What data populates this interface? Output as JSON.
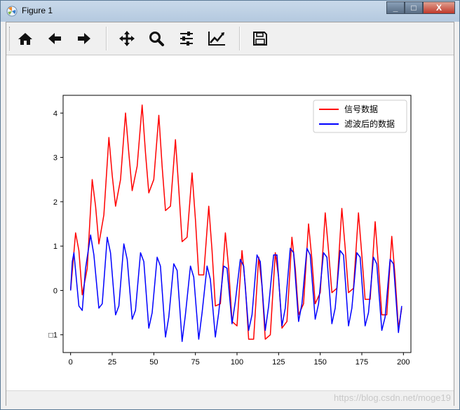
{
  "window": {
    "title": "Figure 1",
    "minimize": "_",
    "maximize": "□",
    "close": "X"
  },
  "toolbar": {
    "buttons": [
      {
        "name": "home",
        "icon": "home-icon"
      },
      {
        "name": "back",
        "icon": "arrow-left-icon"
      },
      {
        "name": "forward",
        "icon": "arrow-right-icon"
      },
      {
        "name": "pan",
        "icon": "move-icon"
      },
      {
        "name": "zoom",
        "icon": "magnifier-icon"
      },
      {
        "name": "subplots",
        "icon": "sliders-icon"
      },
      {
        "name": "edit-axis",
        "icon": "line-chart-icon"
      },
      {
        "name": "save",
        "icon": "floppy-disk-icon"
      }
    ]
  },
  "status": {
    "watermark": "https://blog.csdn.net/moge19"
  },
  "chart_data": {
    "type": "line",
    "title": "",
    "xlabel": "",
    "ylabel": "",
    "xlim": [
      -4.5,
      204.5
    ],
    "ylim": [
      -1.4,
      4.4
    ],
    "xticks": [
      "0",
      "25",
      "50",
      "75",
      "100",
      "125",
      "150",
      "175",
      "200"
    ],
    "yticks": [
      "□1",
      "0",
      "1",
      "2",
      "3",
      "4"
    ],
    "legend_position": "top-right",
    "series": [
      {
        "name": "信号数据",
        "color": "#ff0000",
        "x": [
          0,
          3,
          5,
          7,
          10,
          13,
          15,
          17,
          20,
          23,
          25,
          27,
          30,
          33,
          35,
          37,
          40,
          43,
          45,
          47,
          50,
          53,
          55,
          57,
          60,
          63,
          65,
          67,
          70,
          73,
          75,
          77,
          80,
          83,
          85,
          87,
          90,
          93,
          95,
          97,
          100,
          103,
          105,
          107,
          110,
          113,
          115,
          117,
          120,
          123,
          125,
          127,
          130,
          133,
          135,
          137,
          140,
          143,
          145,
          147,
          150,
          153,
          155,
          157,
          160,
          163,
          165,
          167,
          170,
          173,
          175,
          177,
          180,
          183,
          185,
          187,
          190,
          193,
          195,
          197,
          199
        ],
        "y": [
          0,
          1.3,
          0.9,
          -0.1,
          0.5,
          2.5,
          1.9,
          1.05,
          1.7,
          3.45,
          2.6,
          1.9,
          2.5,
          4.0,
          3.1,
          2.25,
          2.8,
          4.18,
          3.1,
          2.2,
          2.5,
          3.95,
          2.8,
          1.8,
          1.9,
          3.4,
          2.3,
          1.1,
          1.2,
          2.65,
          1.6,
          0.35,
          0.35,
          1.9,
          0.9,
          -0.35,
          -0.3,
          1.3,
          0.5,
          -0.7,
          -0.8,
          0.9,
          0.1,
          -1.1,
          -1.1,
          0.75,
          0.1,
          -1.1,
          -1.0,
          0.85,
          0.3,
          -0.85,
          -0.7,
          1.2,
          0.5,
          -0.55,
          -0.3,
          1.5,
          0.7,
          -0.3,
          -0.05,
          1.75,
          0.9,
          -0.05,
          0.05,
          1.85,
          0.95,
          -0.05,
          0.05,
          1.75,
          0.8,
          -0.2,
          -0.2,
          1.55,
          0.55,
          -0.55,
          -0.55,
          1.22,
          0.3,
          -0.85,
          -0.4
        ]
      },
      {
        "name": "滤波后的数据",
        "color": "#0000ff",
        "x": [
          0,
          1,
          2,
          5,
          7,
          9,
          12,
          14,
          17,
          19,
          22,
          24,
          27,
          29,
          32,
          34,
          37,
          39,
          42,
          44,
          47,
          49,
          52,
          54,
          57,
          59,
          62,
          64,
          67,
          69,
          72,
          74,
          77,
          79,
          82,
          84,
          87,
          89,
          92,
          94,
          97,
          99,
          102,
          104,
          107,
          109,
          112,
          114,
          117,
          119,
          122,
          124,
          127,
          129,
          132,
          134,
          137,
          139,
          142,
          144,
          147,
          149,
          152,
          154,
          157,
          159,
          162,
          164,
          167,
          169,
          172,
          174,
          177,
          179,
          182,
          184,
          187,
          189,
          192,
          194,
          197,
          199
        ],
        "y": [
          0,
          0.65,
          0.85,
          -0.35,
          -0.45,
          0.5,
          1.25,
          0.8,
          -0.4,
          -0.3,
          1.2,
          0.85,
          -0.55,
          -0.35,
          1.05,
          0.7,
          -0.65,
          -0.45,
          0.85,
          0.65,
          -0.85,
          -0.5,
          0.75,
          0.55,
          -1.05,
          -0.6,
          0.6,
          0.45,
          -1.15,
          -0.55,
          0.55,
          0.3,
          -1.1,
          -0.5,
          0.55,
          0.25,
          -1.05,
          -0.5,
          0.55,
          0.5,
          -0.75,
          -0.25,
          0.7,
          0.55,
          -0.9,
          -0.55,
          0.8,
          0.65,
          -0.9,
          -0.35,
          0.8,
          0.8,
          -0.8,
          -0.4,
          0.95,
          0.85,
          -0.7,
          -0.3,
          0.95,
          0.8,
          -0.65,
          -0.3,
          0.85,
          0.75,
          -0.75,
          -0.4,
          0.9,
          0.8,
          -0.8,
          -0.4,
          0.85,
          0.75,
          -0.8,
          -0.5,
          0.75,
          0.6,
          -0.9,
          -0.6,
          0.7,
          0.6,
          -0.95,
          -0.35
        ]
      }
    ]
  }
}
